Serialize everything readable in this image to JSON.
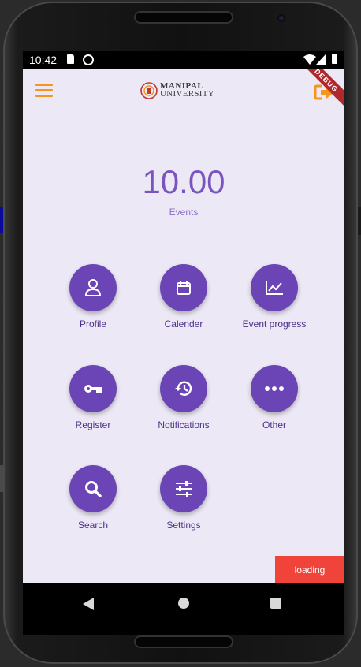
{
  "status_bar": {
    "time": "10:42"
  },
  "app_bar": {
    "logo_line1": "MANIPAL",
    "logo_line2": "UNIVERSITY",
    "debug_banner": "DEBUG",
    "accent_color": "#f5951d"
  },
  "counter": {
    "value": "10.00",
    "label": "Events"
  },
  "tiles": [
    {
      "label": "Profile",
      "icon": "person-icon"
    },
    {
      "label": "Calender",
      "icon": "calendar-icon"
    },
    {
      "label": "Event progress",
      "icon": "chart-line-icon"
    },
    {
      "label": "Register",
      "icon": "key-icon"
    },
    {
      "label": "Notifications",
      "icon": "history-icon"
    },
    {
      "label": "Other",
      "icon": "more-horizontal-icon"
    },
    {
      "label": "Search",
      "icon": "search-icon"
    },
    {
      "label": "Settings",
      "icon": "sliders-icon"
    }
  ],
  "toast": {
    "text": "loading"
  },
  "colors": {
    "background": "#ece8f5",
    "tile": "#6b45b5",
    "toast": "#f0443a"
  }
}
